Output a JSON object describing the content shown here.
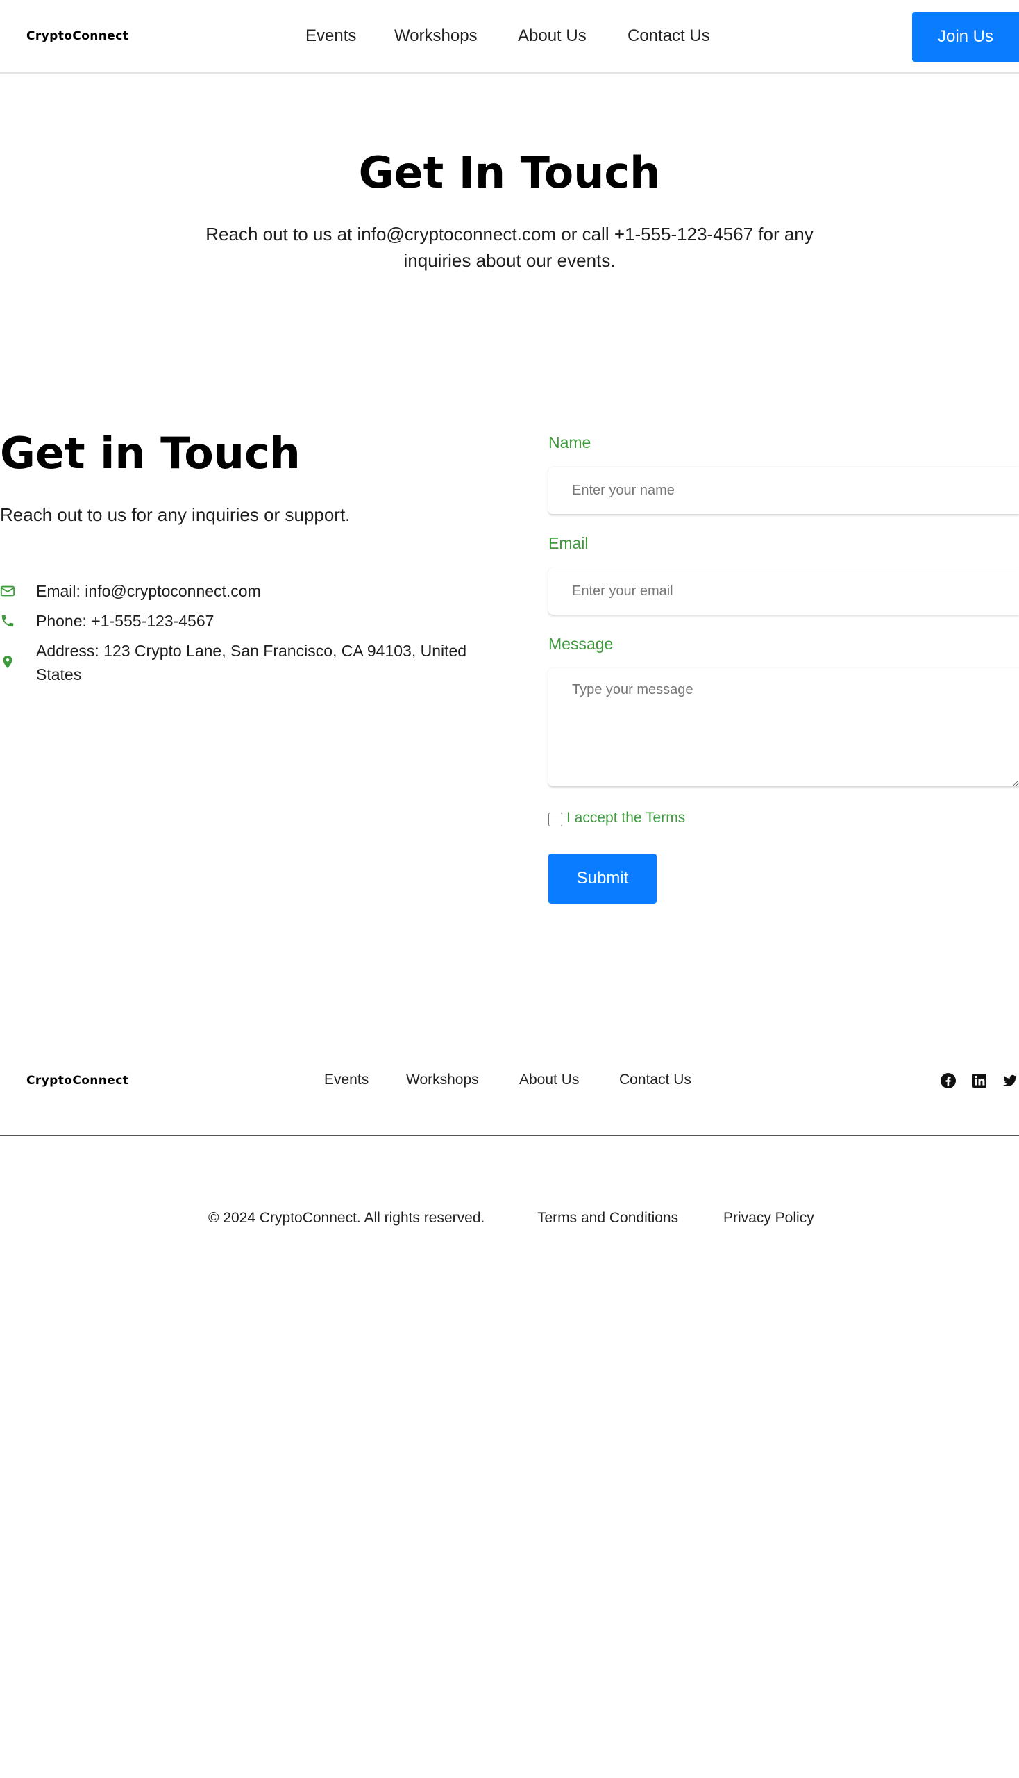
{
  "header": {
    "brand": "CryptoConnect",
    "nav": [
      "Events",
      "Workshops",
      "About Us",
      "Contact Us"
    ],
    "cta": "Join Us"
  },
  "hero": {
    "title": "Get In Touch",
    "text": "Reach out to us at info@cryptoconnect.com or call +1-555-123-4567 for any inquiries about our events."
  },
  "contact": {
    "title": "Get in Touch",
    "subtitle": "Reach out to us for any inquiries or support.",
    "items": [
      {
        "icon": "envelope-icon",
        "text": "Email: info@cryptoconnect.com"
      },
      {
        "icon": "phone-icon",
        "text": "Phone: +1-555-123-4567"
      },
      {
        "icon": "map-pin-icon",
        "text": "Address: 123 Crypto Lane, San Francisco, CA 94103, United States"
      }
    ]
  },
  "form": {
    "name_label": "Name",
    "name_placeholder": "Enter your name",
    "email_label": "Email",
    "email_placeholder": "Enter your email",
    "message_label": "Message",
    "message_placeholder": "Type your message",
    "terms_label": "I accept the Terms",
    "terms_checked": false,
    "submit": "Submit"
  },
  "footer": {
    "brand": "CryptoConnect",
    "nav": [
      "Events",
      "Workshops",
      "About Us",
      "Contact Us"
    ],
    "social": [
      "facebook-icon",
      "linkedin-icon",
      "twitter-icon"
    ],
    "copyright": "© 2024 CryptoConnect. All rights reserved.",
    "links": [
      "Terms and Conditions",
      "Privacy Policy"
    ]
  },
  "colors": {
    "primary": "#0a7cff",
    "accent_green": "#3f9a3d",
    "text": "#1e1e1e"
  }
}
